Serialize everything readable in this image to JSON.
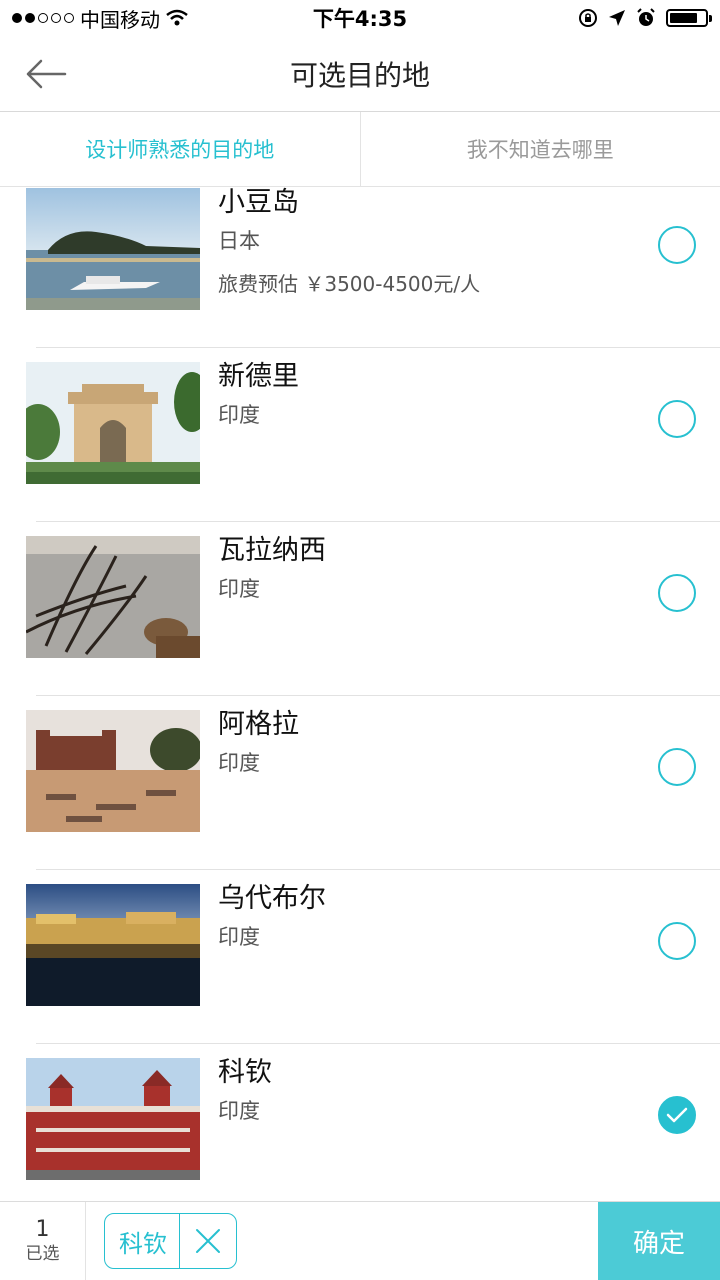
{
  "status_bar": {
    "carrier": "中国移动",
    "time": "下午4:35"
  },
  "nav": {
    "title": "可选目的地"
  },
  "tabs": [
    {
      "label": "设计师熟悉的目的地",
      "active": true
    },
    {
      "label": "我不知道去哪里",
      "active": false
    }
  ],
  "destinations": [
    {
      "name": "小豆岛",
      "country": "日本",
      "cost_label": "旅费预估",
      "cost": "￥3500-4500元/人",
      "selected": false
    },
    {
      "name": "新德里",
      "country": "印度",
      "selected": false
    },
    {
      "name": "瓦拉纳西",
      "country": "印度",
      "selected": false
    },
    {
      "name": "阿格拉",
      "country": "印度",
      "selected": false
    },
    {
      "name": "乌代布尔",
      "country": "印度",
      "selected": false
    },
    {
      "name": "科钦",
      "country": "印度",
      "selected": true
    }
  ],
  "bottom": {
    "count": "1",
    "count_label": "已选",
    "chip_label": "科钦",
    "confirm_label": "确定"
  },
  "colors": {
    "accent": "#27c0d0",
    "confirm_bg": "#4ccbd6"
  }
}
